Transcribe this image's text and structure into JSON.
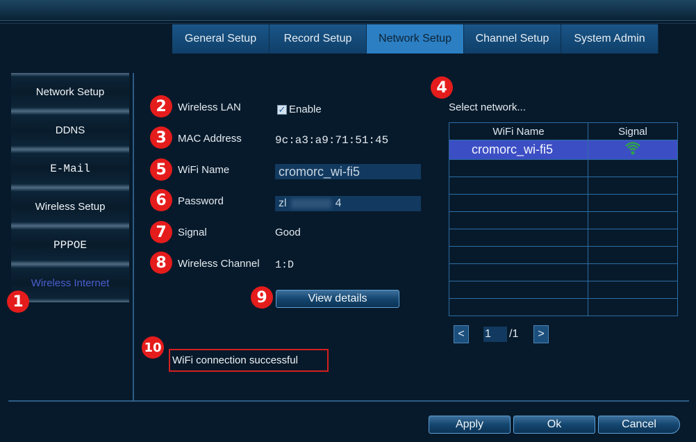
{
  "tabs": [
    "General Setup",
    "Record Setup",
    "Network Setup",
    "Channel Setup",
    "System Admin"
  ],
  "sidebar": [
    "Network Setup",
    "DDNS",
    "E-Mail",
    "Wireless Setup",
    "PPPOE",
    "Wireless Internet"
  ],
  "badges": [
    "1",
    "2",
    "3",
    "4",
    "5",
    "6",
    "7",
    "8",
    "9",
    "10"
  ],
  "form": {
    "wireless_lan_label": "Wireless LAN",
    "enable_label": "Enable",
    "mac_label": "MAC Address",
    "mac_value": "9c:a3:a9:71:51:45",
    "wifi_name_label": "WiFi Name",
    "wifi_name_value": "cromorc_wi-fi5",
    "password_label": "Password",
    "password_prefix": "zl",
    "password_suffix": "4",
    "signal_label": "Signal",
    "signal_value": "Good",
    "channel_label": "Wireless Channel",
    "channel_value": "1:D",
    "view_details": "View details"
  },
  "network": {
    "select_label": "Select network...",
    "col_name": "WiFi Name",
    "col_signal": "Signal",
    "rows": [
      {
        "name": "cromorc_wi-fi5",
        "signal_icon": "wifi-signal-icon"
      }
    ],
    "page_current": "1",
    "page_total": "/1"
  },
  "status": "WiFi connection successful",
  "footer": {
    "apply": "Apply",
    "ok": "Ok",
    "cancel": "Cancel"
  },
  "colors": {
    "accent": "#2c7fc3",
    "badge": "#e51c1c",
    "selected_row": "#3c4ec4",
    "wifi_icon": "#2fa24a"
  }
}
